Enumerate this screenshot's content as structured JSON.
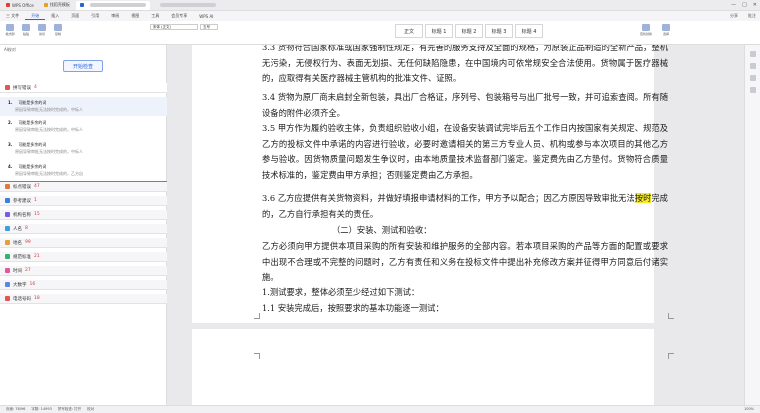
{
  "titlebar": {
    "tabs": [
      {
        "label": "WPS Office",
        "color": "#e03c31"
      },
      {
        "label": "找稻壳模板",
        "color": "#e8a020"
      }
    ]
  },
  "menubar": {
    "items": [
      "三 文件",
      "开始",
      "插入",
      "页面",
      "引用",
      "审阅",
      "视图",
      "工具",
      "会员专享",
      "WPS AI"
    ],
    "active_index": 1,
    "right": [
      "分享",
      "批注"
    ]
  },
  "ribbon": {
    "buttons": [
      "格式刷",
      "粘贴",
      "剪切",
      "复制"
    ],
    "font_name": "宋体 (正文)",
    "font_size": "五号",
    "styles": [
      "正文",
      "标题 1",
      "标题 2",
      "标题 3",
      "标题 4"
    ],
    "find_label": "查找替换",
    "select_label": "选择"
  },
  "sidebar": {
    "title": "AI校对",
    "check_button": "开始检查",
    "categories": [
      {
        "label": "拼写错误",
        "count": "4",
        "color": "#e05656",
        "open": true
      },
      {
        "label": "标点错误",
        "count": "47",
        "color": "#e07a3a"
      },
      {
        "label": "参考建议",
        "count": "1",
        "color": "#3a7ee0"
      },
      {
        "label": "机构名称",
        "count": "15",
        "color": "#7a5ae0"
      },
      {
        "label": "人名",
        "count": "8",
        "color": "#3aa0e0"
      },
      {
        "label": "地名",
        "count": "99",
        "color": "#e0a03a"
      },
      {
        "label": "规范标准",
        "count": "21",
        "color": "#3ab070"
      },
      {
        "label": "时间",
        "count": "27",
        "color": "#e05a9a"
      },
      {
        "label": "大数字",
        "count": "16",
        "color": "#5a8ae0"
      },
      {
        "label": "电话号码",
        "count": "18",
        "color": "#e05656"
      }
    ],
    "items": [
      {
        "num": "1.",
        "title": "按时",
        "hint": "可能是多余的词",
        "desc": "原因导致审批无法按时完成的，中标人"
      },
      {
        "num": "2.",
        "title": "按时",
        "hint": "可能是多余的词",
        "desc": "原因导致审批无法按时完成的，中标人"
      },
      {
        "num": "3.",
        "title": "按时",
        "hint": "可能是多余的词",
        "desc": "原因导致审批无法按时完成的，中标人"
      },
      {
        "num": "4.",
        "title": "按时",
        "hint": "可能是多余的词",
        "desc": "原因导致审批无法按时完成的，乙方自"
      }
    ]
  },
  "document": {
    "p0": "3.3  货物符合国家标准或国家强制性规定，有完善的服务支持及全面的规格，为原装正品制造的全新产品，整机无污染，无侵权行为、表面无划损、无任何缺陷隐患，在中国境内可依常规安全合法使用。货物属于医疗器械的，应取得有关医疗器械主管机构的批准文件、证照。",
    "p1": "3.4  货物为原厂商未启封全新包装，具出厂合格证，序列号、包装箱号与出厂批号一致，并可追索查阅。所有随设备的附件必须齐全。",
    "p2": "3.5  甲方作为履约验收主体，负责组织验收小组，在设备安装调试完毕后五个工作日内按国家有关规定、规范及乙方的投标文件中承诺的内容进行验收，必要时邀请相关的第三方专业人员、机构或参与本次项目的其他乙方参与验收。因货物质量问题发生争议时，由本地质量技术监督部门鉴定。鉴定费先由乙方垫付。货物符合质量技术标准的，鉴定费由甲方承担；否则鉴定费由乙方承担。",
    "p3a": "3.6  乙方应提供有关货物资料，并做好填报申请材料的工作，甲方予以配合；因乙方原因导致审批无法",
    "p3hl": "按时",
    "p3b": "完成的，乙方自行承担有关的责任。",
    "p4": "（二）安装、测试和验收：",
    "p5": "乙方必须向甲方提供本项目采购的所有安装和维护服务的全部内容。若本项目采购的产品等方面的配置或要求中出现不合理或不完整的问题时，乙方有责任和义务在投标文件中提出补充修改方案并征得甲方同意后付诸实施。",
    "p6": "1.测试要求，整体必须至少经过如下测试：",
    "p7": "1.1  安装完成后，按照要求的基本功能逐一测试："
  },
  "statusbar": {
    "page": "页面: 78/96",
    "words": "字数: 14993",
    "spell": "拼写检查: 打开",
    "proof": "校对",
    "zoom": "100%"
  }
}
